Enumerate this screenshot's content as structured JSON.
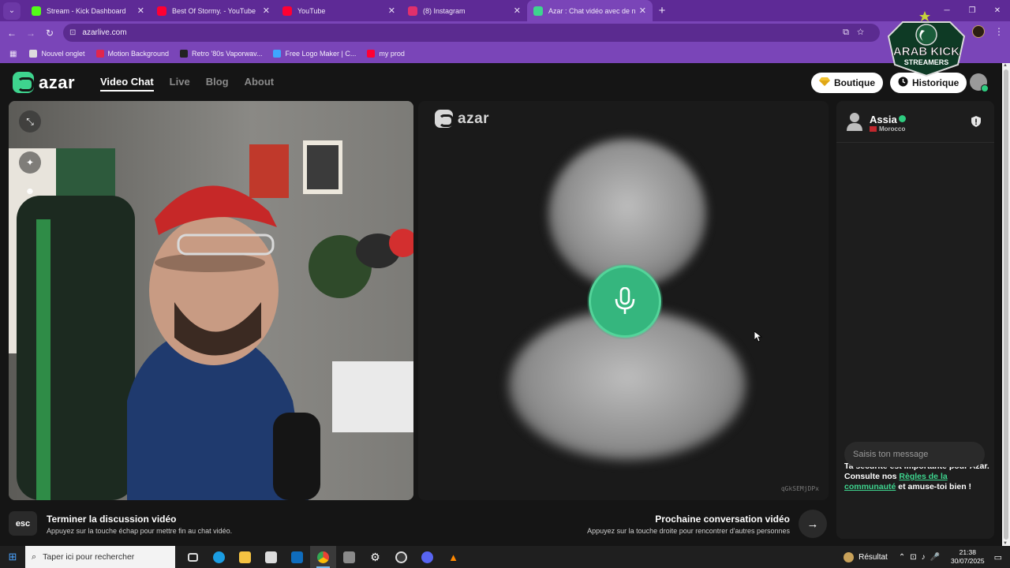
{
  "browser": {
    "tabs": [
      {
        "title": "Stream - Kick Dashboard",
        "color": "#53fc18",
        "active": false
      },
      {
        "title": "Best Of Stormy. - YouTube",
        "color": "#ff0033",
        "active": false
      },
      {
        "title": "YouTube",
        "color": "#ff0033",
        "active": false
      },
      {
        "title": "(8) Instagram",
        "color": "#e1306c",
        "active": false
      },
      {
        "title": "Azar : Chat vidéo avec de n",
        "color": "#3ed48e",
        "active": true
      }
    ],
    "url": "azarlive.com",
    "bookmarks": [
      {
        "label": "Nouvel onglet",
        "color": "#dddddd"
      },
      {
        "label": "Motion Background",
        "color": "#e2264d"
      },
      {
        "label": "Retro '80s Vaporwav...",
        "color": "#222222"
      },
      {
        "label": "Free Logo Maker | C...",
        "color": "#3ea6ff"
      },
      {
        "label": "my prod",
        "color": "#ff0033"
      }
    ]
  },
  "overlay_logo": {
    "line1": "ARAB KICK",
    "line2": "STREAMERS"
  },
  "azar": {
    "logo_text": "azar",
    "nav": [
      "Video Chat",
      "Live",
      "Blog",
      "About"
    ],
    "boutique_label": "Boutique",
    "historique_label": "Historique",
    "partner_logo_text": "azar",
    "partner_code": "qGkSEMjDPx",
    "end_title": "Terminer la discussion vidéo",
    "end_hint": "Appuyez sur la touche échap pour mettre fin au chat vidéo.",
    "esc_label": "esc",
    "next_title": "Prochaine conversation vidéo",
    "next_hint": "Appuyez sur la touche droite pour rencontrer d'autres personnes",
    "chat": {
      "partner_name": "Assia",
      "partner_country": "Morocco",
      "safety_before": "Ta sécurité est importante pour Azar. Consulte nos ",
      "safety_link": "Règles de la communauté",
      "safety_after": " et amuse-toi bien !",
      "input_placeholder": "Saisis ton message"
    },
    "accent_color": "#3ed48e"
  },
  "taskbar": {
    "search_placeholder": "Taper ici pour rechercher",
    "weather_label": "Résultat",
    "time": "21:38",
    "date": "30/07/2025"
  }
}
